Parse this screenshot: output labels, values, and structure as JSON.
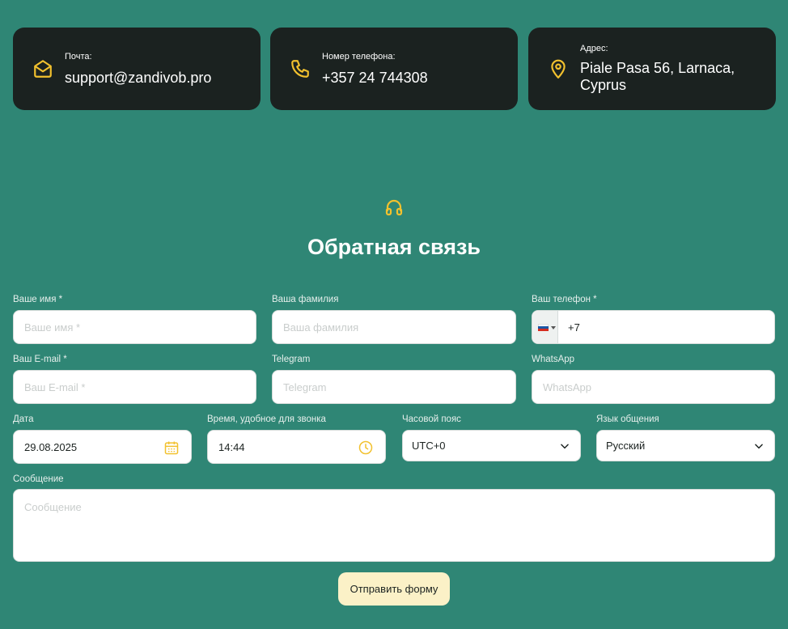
{
  "colors": {
    "background": "#2f8675",
    "card": "#1b2220",
    "accent": "#f2c12e",
    "button": "#fbf1c7"
  },
  "contacts": [
    {
      "icon": "envelope-icon",
      "label": "Почта:",
      "value": "support@zandivob.pro"
    },
    {
      "icon": "phone-icon",
      "label": "Номер телефона:",
      "value": "+357 24 744308"
    },
    {
      "icon": "location-pin-icon",
      "label": "Адрес:",
      "value": "Piale Pasa 56, Larnaca, Cyprus"
    }
  ],
  "section": {
    "icon": "headphones-icon",
    "title": "Обратная связь"
  },
  "form": {
    "first_name": {
      "label": "Ваше имя *",
      "placeholder": "Ваше имя *"
    },
    "last_name": {
      "label": "Ваша фамилия",
      "placeholder": "Ваша фамилия"
    },
    "phone": {
      "label": "Ваш телефон *",
      "value": "+7",
      "country": "RU"
    },
    "email": {
      "label": "Ваш E-mail *",
      "placeholder": "Ваш E-mail *"
    },
    "telegram": {
      "label": "Telegram",
      "placeholder": "Telegram"
    },
    "whatsapp": {
      "label": "WhatsApp",
      "placeholder": "WhatsApp"
    },
    "date": {
      "label": "Дата",
      "value": "29.08.2025",
      "icon": "calendar-icon"
    },
    "time": {
      "label": "Время, удобное для звонка",
      "value": "14:44",
      "icon": "clock-icon"
    },
    "timezone": {
      "label": "Часовой пояс",
      "value": "UTC+0"
    },
    "language": {
      "label": "Язык общения",
      "value": "Русский"
    },
    "message": {
      "label": "Сообщение",
      "placeholder": "Сообщение"
    },
    "submit_label": "Отправить форму"
  }
}
